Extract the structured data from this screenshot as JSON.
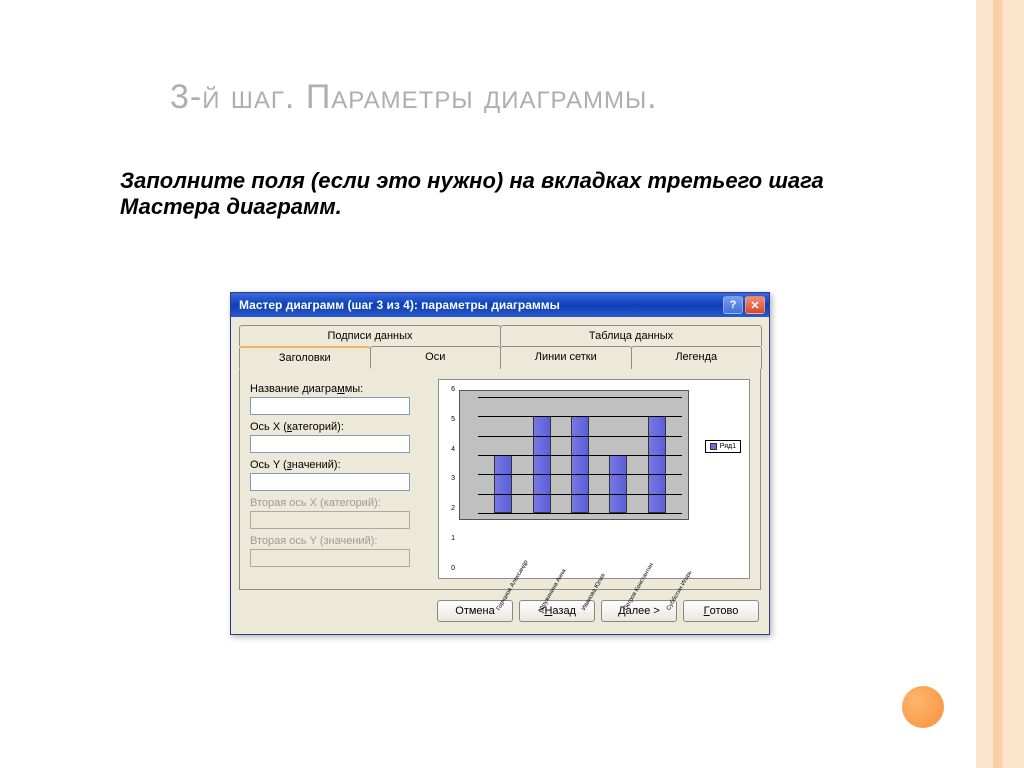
{
  "slide": {
    "title": "3-й шаг. Параметры диаграммы.",
    "subtitle": "Заполните поля (если это нужно) на вкладках третьего шага Мастера диаграмм."
  },
  "dialog": {
    "window_title": "Мастер диаграмм (шаг 3 из 4): параметры диаграммы",
    "tabs_top": [
      "Подписи данных",
      "Таблица данных"
    ],
    "tabs_bottom": [
      "Заголовки",
      "Оси",
      "Линии сетки",
      "Легенда"
    ],
    "active_tab": "Заголовки",
    "labels": {
      "chart_title": "Название диаграммы:",
      "axis_x": "Ось X (категорий):",
      "axis_y": "Ось Y (значений):",
      "axis_x2": "Вторая ось X (категорий):",
      "axis_y2": "Вторая ось Y (значений):"
    },
    "buttons": {
      "cancel": "Отмена",
      "back": "< Назад",
      "next": "Далее >",
      "finish": "Готово"
    },
    "legend_label": "Ряд1"
  },
  "chart_data": {
    "type": "bar",
    "categories": [
      "Горчаков Александр",
      "Дружинина Анна",
      "Иванова Юлия",
      "Петров Константин",
      "Субботин Игорь"
    ],
    "values": [
      3,
      5,
      5,
      3,
      5
    ],
    "title": "",
    "xlabel": "",
    "ylabel": "",
    "ylim": [
      0,
      6
    ],
    "yticks": [
      0,
      1,
      2,
      3,
      4,
      5,
      6
    ],
    "series_name": "Ряд1"
  }
}
